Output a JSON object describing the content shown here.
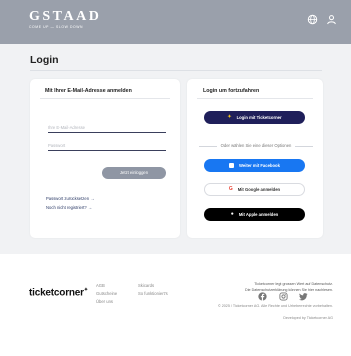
{
  "header": {
    "logo_main": "GSTAAD",
    "logo_sub": "COME UP — SLOW DOWN",
    "icons": [
      "globe-icon",
      "user-icon"
    ]
  },
  "page": {
    "title": "Login"
  },
  "email_login": {
    "title": "Mit Ihrer E-Mail-Adresse anmelden",
    "email_placeholder": "Ihre E-Mail-Adresse",
    "password_placeholder": "Passwort",
    "submit_label": "Jetzt einloggen",
    "forgot_password": "Passwort zurücksetzen",
    "not_registered": "Noch nicht registriert?"
  },
  "continue": {
    "title": "Login um fortzufahren",
    "ticketcorner_label": "Login mit Ticketcorner",
    "or_text": "Oder wählen Sie eine dieser Optionen",
    "facebook_label": "Weiter mit Facebook",
    "google_label": "Mit Google anmelden",
    "apple_label": "Mit Apple anmelden"
  },
  "footer": {
    "brand": "ticketcorner",
    "links_col1": [
      "AGB",
      "Gutscheine",
      "Über uns"
    ],
    "links_col2": [
      "Skicards",
      "So funktioniert's"
    ],
    "privacy_line1": "Ticketcorner legt grossen Wert auf Datenschutz.",
    "privacy_line2": "Die Datenschutzerklärung können Sie hier nachlesen.",
    "copyright": "© 2025 / Ticketcorner AG. Alle Rechte und Urheberrechte vorbehalten.",
    "developed_by": "Developed by Ticketcorner AG",
    "social_icons": [
      "facebook-icon",
      "instagram-icon",
      "twitter-icon"
    ]
  },
  "colors": {
    "header": "#9aa0ab",
    "background": "#f1f2f4",
    "ticketcorner": "#1f1f5a",
    "facebook": "#1877f2",
    "apple": "#000000"
  }
}
